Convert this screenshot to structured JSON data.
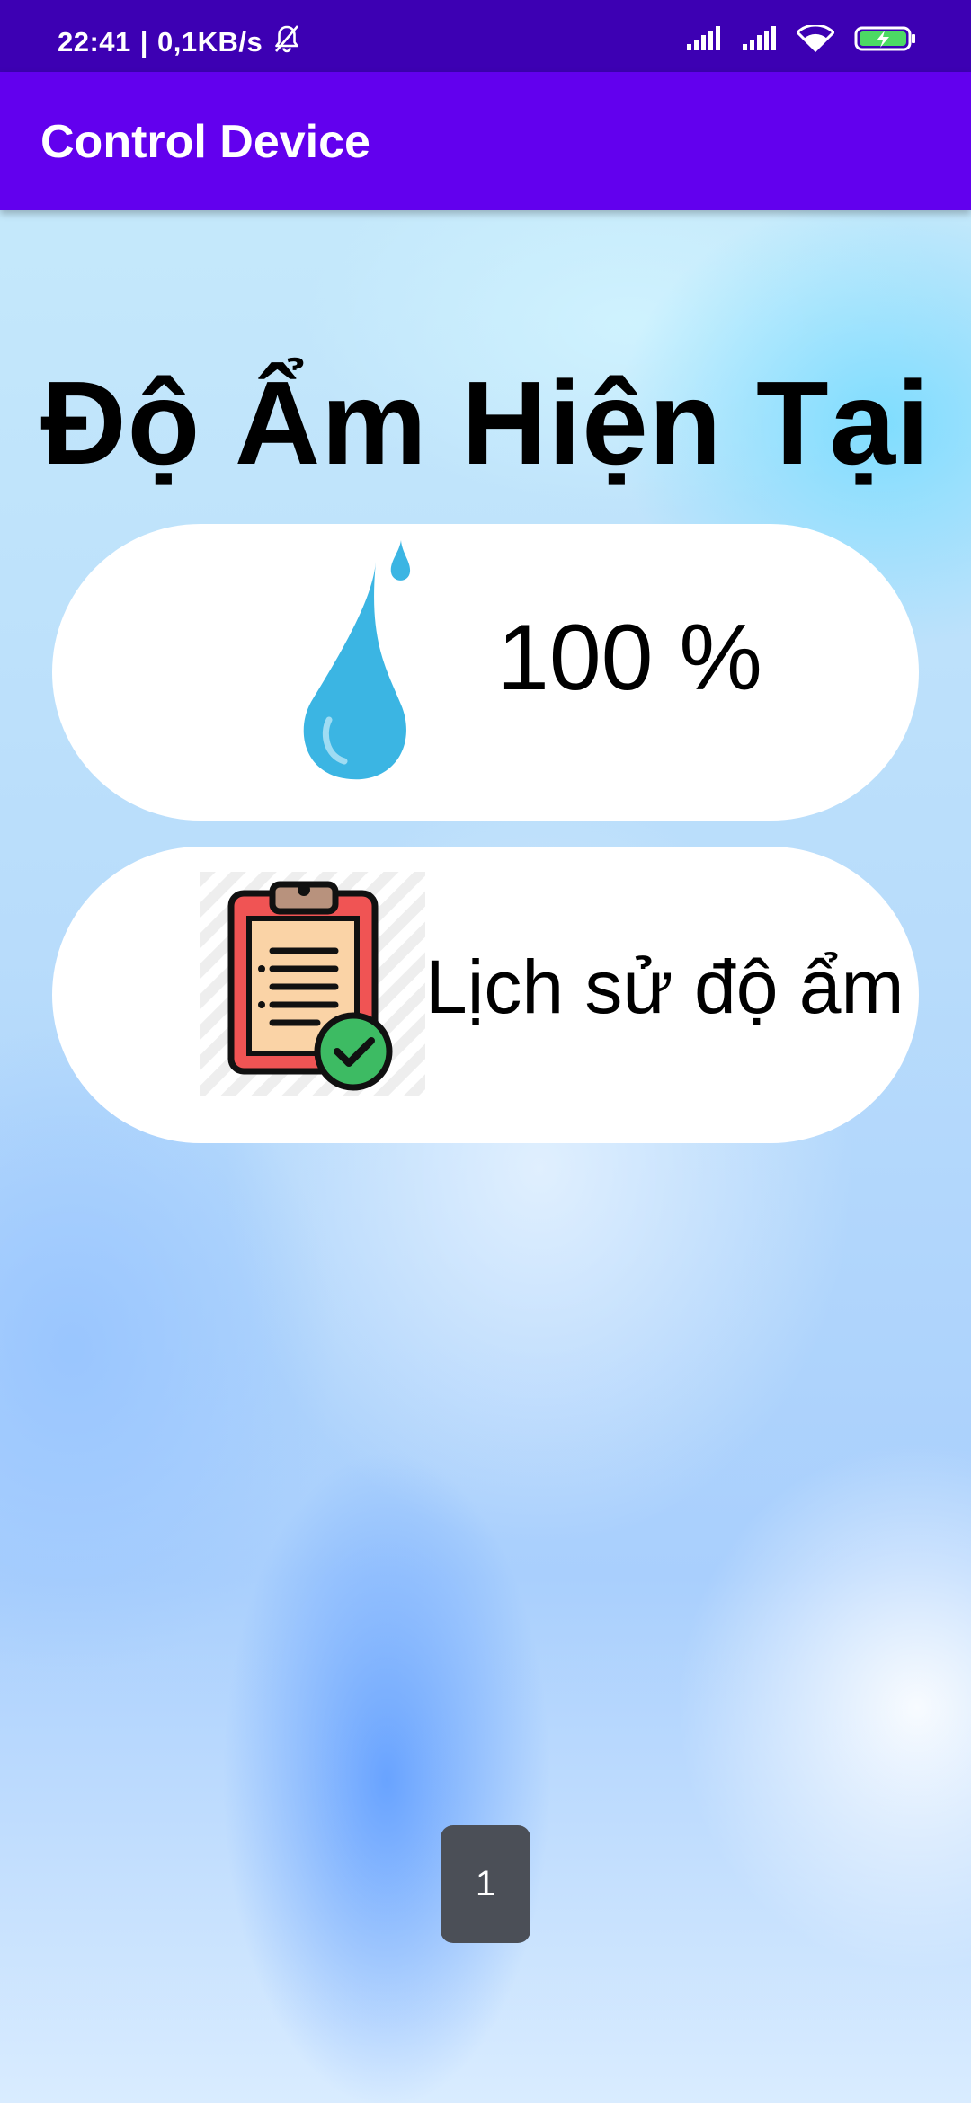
{
  "status_bar": {
    "time": "22:41",
    "separator": "|",
    "network_speed": "0,1KB/s",
    "icons": [
      "bell-muted-icon",
      "signal-icon",
      "signal-icon",
      "wifi-icon",
      "battery-charging-icon"
    ],
    "background_color": "#3d00b3"
  },
  "app_bar": {
    "title": "Control Device",
    "background_color": "#6200ee"
  },
  "main": {
    "heading": "Độ Ẩm Hiện Tại",
    "humidity_card": {
      "icon": "water-drop-icon",
      "value": "100 %"
    },
    "history_card": {
      "icon": "clipboard-check-icon",
      "label": "Lịch sử độ ẩm"
    }
  },
  "page_indicator": {
    "value": "1"
  }
}
